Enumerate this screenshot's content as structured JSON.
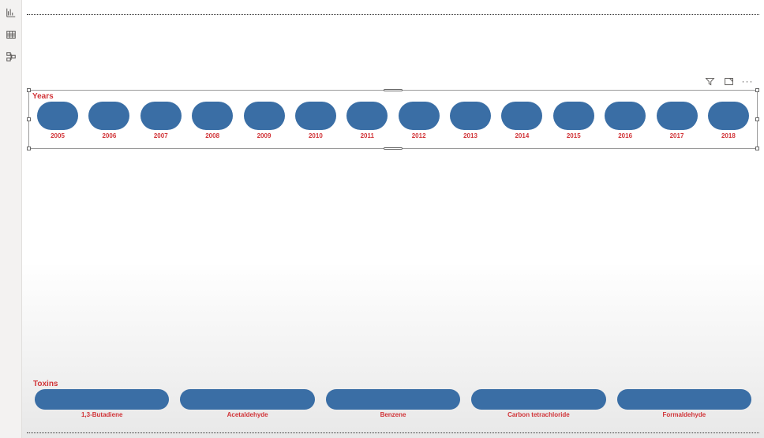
{
  "slicers": {
    "years": {
      "title": "Years",
      "items": [
        {
          "label": "2005"
        },
        {
          "label": "2006"
        },
        {
          "label": "2007"
        },
        {
          "label": "2008"
        },
        {
          "label": "2009"
        },
        {
          "label": "2010"
        },
        {
          "label": "2011"
        },
        {
          "label": "2012"
        },
        {
          "label": "2013"
        },
        {
          "label": "2014"
        },
        {
          "label": "2015"
        },
        {
          "label": "2016"
        },
        {
          "label": "2017"
        },
        {
          "label": "2018"
        }
      ]
    },
    "toxins": {
      "title": "Toxins",
      "items": [
        {
          "label": "1,3-Butadiene"
        },
        {
          "label": "Acetaldehyde"
        },
        {
          "label": "Benzene"
        },
        {
          "label": "Carbon tetrachloride"
        },
        {
          "label": "Formaldehyde"
        }
      ]
    }
  },
  "visual_toolbar": {
    "more": "···"
  }
}
